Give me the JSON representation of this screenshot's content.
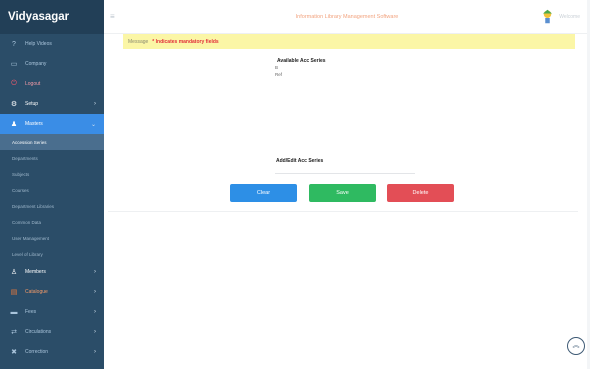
{
  "brand": {
    "title": "Vidyasagar"
  },
  "topbar": {
    "title": "Information Library Management Software",
    "user_name": "Welcome"
  },
  "sidebar": {
    "items": [
      {
        "label": "Help Videos",
        "icon": "question-icon"
      },
      {
        "label": "Company",
        "icon": "monitor-icon"
      },
      {
        "label": "Logout",
        "icon": "power-icon"
      },
      {
        "label": "Setup",
        "icon": "gear-icon"
      },
      {
        "label": "Masters",
        "icon": "users-icon"
      }
    ],
    "masters_sub": [
      "Accession Series",
      "Departments",
      "Subjects",
      "Courses",
      "Department Libraries",
      "Common Data",
      "User Management",
      "Level of Library"
    ],
    "lower_items": [
      {
        "label": "Members",
        "icon": "person-icon"
      },
      {
        "label": "Catalogue",
        "icon": "book-icon"
      },
      {
        "label": "Fees",
        "icon": "card-icon"
      },
      {
        "label": "Circulations",
        "icon": "exchange-icon"
      },
      {
        "label": "Correction",
        "icon": "tools-icon"
      }
    ]
  },
  "message": {
    "tag": "Message",
    "text": "* Indicates mandatory fields"
  },
  "form": {
    "available_label": "Available Acc Series",
    "series": [
      "B",
      "Ref"
    ],
    "add_edit_label": "Add/Edit Acc Series",
    "input_value": ""
  },
  "buttons": {
    "clear": "Clear",
    "save": "Save",
    "delete": "Delete"
  },
  "colors": {
    "sidebar_bg": "#2b4d68",
    "active_bg": "#3a8de6",
    "clear_btn": "#2d8fe6",
    "save_btn": "#2fba61",
    "delete_btn": "#e34e56",
    "message_bg": "#fbf6a6",
    "message_text": "#e2303b"
  }
}
